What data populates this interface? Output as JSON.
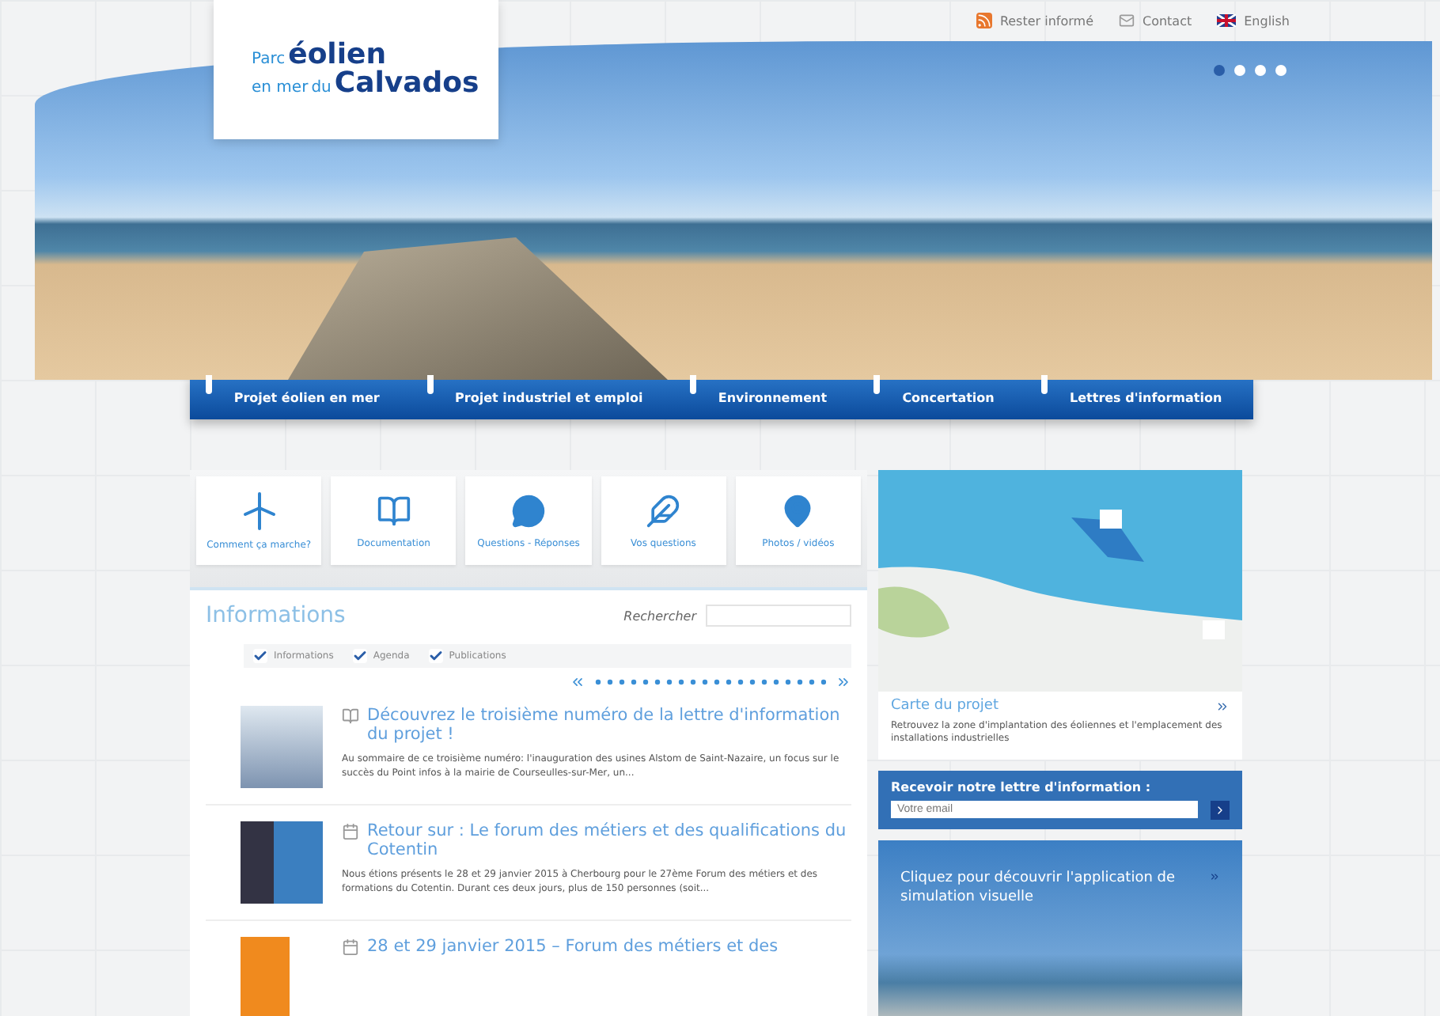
{
  "header": {
    "logo": {
      "small_1": "Parc",
      "big_1": "éolien",
      "small_2": "en mer",
      "mid_2": "du",
      "big_2": "Calvados"
    },
    "top_links": [
      {
        "kind": "rss",
        "label": "Rester informé"
      },
      {
        "kind": "mail",
        "label": "Contact"
      },
      {
        "kind": "flag",
        "label": "English"
      }
    ],
    "carousel_dots": [
      {
        "selected": true
      },
      {
        "selected": false
      },
      {
        "selected": false
      },
      {
        "selected": false
      }
    ]
  },
  "nav": [
    "Projet éolien en mer",
    "Projet industriel et emploi",
    "Environnement",
    "Concertation",
    "Lettres d'information"
  ],
  "shortcuts": [
    {
      "kind": "turbine",
      "label": "Comment ça marche?"
    },
    {
      "kind": "book",
      "label": "Documentation"
    },
    {
      "kind": "chat",
      "label": "Questions - Réponses"
    },
    {
      "kind": "feather",
      "label": "Vos questions"
    },
    {
      "kind": "pin",
      "label": "Photos / vidéos"
    }
  ],
  "news": {
    "title": "Informations",
    "search_label": "Rechercher",
    "filters": [
      {
        "label": "Informations",
        "checked": true
      },
      {
        "label": "Agenda",
        "checked": true
      },
      {
        "label": "Publications",
        "checked": true
      }
    ],
    "items": [
      {
        "kind": "letter",
        "title": "Découvrez le troisième numéro de la lettre d'information du projet !",
        "summary": "Au sommaire de ce troisième numéro: l'inauguration des usines Alstom de Saint-Nazaire, un focus sur le succès du Point infos à la mairie de Courseulles-sur-Mer, un..."
      },
      {
        "kind": "event",
        "title": "Retour sur : Le forum des métiers et des qualifications du Cotentin",
        "summary": "Nous étions présents le 28 et 29 janvier 2015 à Cherbourg pour le 27ème Forum des métiers et des formations du Cotentin. Durant ces deux jours, plus de 150 personnes (soit..."
      },
      {
        "kind": "event",
        "title": "28 et 29 janvier 2015 – Forum des métiers et des"
      }
    ]
  },
  "map_card": {
    "title": "Carte du projet",
    "text": "Retrouvez la zone d'implantation des éoliennes et l'emplacement des installations industrielles"
  },
  "newsletter": {
    "title": "Recevoir notre lettre d'information :",
    "placeholder": "Votre email"
  },
  "simulation": {
    "text": "Cliquez pour découvrir l'application de simulation visuelle"
  }
}
